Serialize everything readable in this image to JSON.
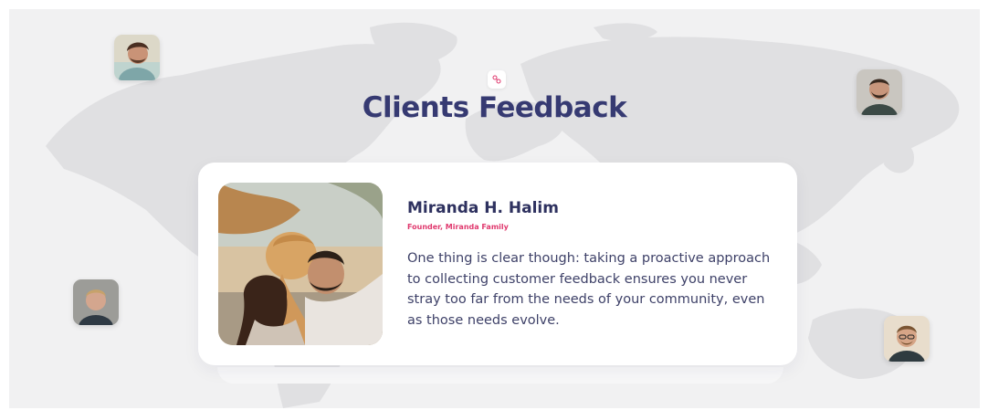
{
  "section": {
    "title": "Clients Feedback",
    "quote_icon": "quote-icon"
  },
  "testimonial": {
    "name": "Miranda H. Halim",
    "role": "Founder, Miranda Family",
    "text": "One thing is clear though: taking a proactive approach to collecting customer feedback ensures you never stray too far from the needs of your community, even as those needs evolve."
  },
  "colors": {
    "title": "#363a72",
    "accent": "#e0396e",
    "background": "#f1f1f2",
    "map": "#e0e0e2"
  }
}
